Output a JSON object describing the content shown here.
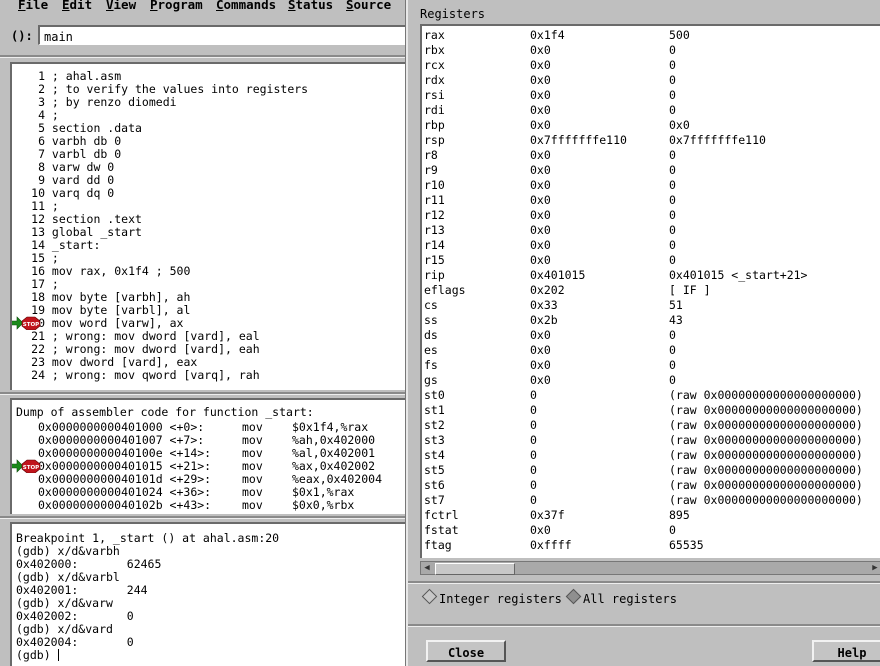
{
  "menu": [
    "File",
    "Edit",
    "View",
    "Program",
    "Commands",
    "Status",
    "Source"
  ],
  "argument": {
    "label": "():",
    "value": "main"
  },
  "source": {
    "lines": [
      {
        "n": "1",
        "text": "; ahal.asm"
      },
      {
        "n": "2",
        "text": "; to verify the values into registers"
      },
      {
        "n": "3",
        "text": "; by renzo diomedi"
      },
      {
        "n": "4",
        "text": ";"
      },
      {
        "n": "5",
        "text": "section .data"
      },
      {
        "n": "6",
        "text": "varbh db 0"
      },
      {
        "n": "7",
        "text": "varbl db 0"
      },
      {
        "n": "8",
        "text": "varw dw 0"
      },
      {
        "n": "9",
        "text": "vard dd 0"
      },
      {
        "n": "10",
        "text": "varq dq 0"
      },
      {
        "n": "11",
        "text": ";"
      },
      {
        "n": "12",
        "text": "section .text"
      },
      {
        "n": "13",
        "text": "global _start"
      },
      {
        "n": "14",
        "text": "_start:"
      },
      {
        "n": "15",
        "text": ";"
      },
      {
        "n": "16",
        "text": "mov rax, 0x1f4 ; 500"
      },
      {
        "n": "17",
        "text": ";"
      },
      {
        "n": "18",
        "text": "mov byte [varbh], ah"
      },
      {
        "n": "19",
        "text": "mov byte [varbl], al"
      },
      {
        "n": "20",
        "text": "mov word [varw], ax"
      },
      {
        "n": "21",
        "text": "; wrong: mov dword [vard], eal"
      },
      {
        "n": "22",
        "text": "; wrong: mov dword [vard], eah"
      },
      {
        "n": "23",
        "text": "mov dword [vard], eax"
      },
      {
        "n": "24",
        "text": "; wrong: mov qword [varq], rah"
      }
    ]
  },
  "assembly": {
    "header": "Dump of assembler code for function _start:",
    "lines": [
      {
        "addr": "0x0000000000401000 <+0>:",
        "op": "mov",
        "args": "$0x1f4,%rax"
      },
      {
        "addr": "0x0000000000401007 <+7>:",
        "op": "mov",
        "args": "%ah,0x402000"
      },
      {
        "addr": "0x000000000040100e <+14>:",
        "op": "mov",
        "args": "%al,0x402001"
      },
      {
        "addr": "0x0000000000401015 <+21>:",
        "op": "mov",
        "args": "%ax,0x402002"
      },
      {
        "addr": "0x000000000040101d <+29>:",
        "op": "mov",
        "args": "%eax,0x402004"
      },
      {
        "addr": "0x0000000000401024 <+36>:",
        "op": "mov",
        "args": "$0x1,%rax"
      },
      {
        "addr": "0x000000000040102b <+43>:",
        "op": "mov",
        "args": "$0x0,%rbx"
      }
    ]
  },
  "console": {
    "lines": [
      "Breakpoint 1, _start () at ahal.asm:20",
      "(gdb) x/d&varbh",
      "0x402000:       62465",
      "(gdb) x/d&varbl",
      "0x402001:       244",
      "(gdb) x/d&varw",
      "0x402002:       0",
      "(gdb) x/d&vard",
      "0x402004:       0",
      "(gdb) "
    ]
  },
  "stop_marker_text": "STOP",
  "registers_window": {
    "title": "Registers",
    "rows": [
      {
        "name": "rax",
        "hex": "0x1f4",
        "natural": "500"
      },
      {
        "name": "rbx",
        "hex": "0x0",
        "natural": "0"
      },
      {
        "name": "rcx",
        "hex": "0x0",
        "natural": "0"
      },
      {
        "name": "rdx",
        "hex": "0x0",
        "natural": "0"
      },
      {
        "name": "rsi",
        "hex": "0x0",
        "natural": "0"
      },
      {
        "name": "rdi",
        "hex": "0x0",
        "natural": "0"
      },
      {
        "name": "rbp",
        "hex": "0x0",
        "natural": "0x0"
      },
      {
        "name": "rsp",
        "hex": "0x7fffffffe110",
        "natural": "0x7fffffffe110"
      },
      {
        "name": "r8",
        "hex": "0x0",
        "natural": "0"
      },
      {
        "name": "r9",
        "hex": "0x0",
        "natural": "0"
      },
      {
        "name": "r10",
        "hex": "0x0",
        "natural": "0"
      },
      {
        "name": "r11",
        "hex": "0x0",
        "natural": "0"
      },
      {
        "name": "r12",
        "hex": "0x0",
        "natural": "0"
      },
      {
        "name": "r13",
        "hex": "0x0",
        "natural": "0"
      },
      {
        "name": "r14",
        "hex": "0x0",
        "natural": "0"
      },
      {
        "name": "r15",
        "hex": "0x0",
        "natural": "0"
      },
      {
        "name": "rip",
        "hex": "0x401015",
        "natural": "0x401015 <_start+21>"
      },
      {
        "name": "eflags",
        "hex": "0x202",
        "natural": "[ IF ]"
      },
      {
        "name": "cs",
        "hex": "0x33",
        "natural": "51"
      },
      {
        "name": "ss",
        "hex": "0x2b",
        "natural": "43"
      },
      {
        "name": "ds",
        "hex": "0x0",
        "natural": "0"
      },
      {
        "name": "es",
        "hex": "0x0",
        "natural": "0"
      },
      {
        "name": "fs",
        "hex": "0x0",
        "natural": "0"
      },
      {
        "name": "gs",
        "hex": "0x0",
        "natural": "0"
      },
      {
        "name": "st0",
        "hex": "0",
        "natural": "(raw 0x00000000000000000000)"
      },
      {
        "name": "st1",
        "hex": "0",
        "natural": "(raw 0x00000000000000000000)"
      },
      {
        "name": "st2",
        "hex": "0",
        "natural": "(raw 0x00000000000000000000)"
      },
      {
        "name": "st3",
        "hex": "0",
        "natural": "(raw 0x00000000000000000000)"
      },
      {
        "name": "st4",
        "hex": "0",
        "natural": "(raw 0x00000000000000000000)"
      },
      {
        "name": "st5",
        "hex": "0",
        "natural": "(raw 0x00000000000000000000)"
      },
      {
        "name": "st6",
        "hex": "0",
        "natural": "(raw 0x00000000000000000000)"
      },
      {
        "name": "st7",
        "hex": "0",
        "natural": "(raw 0x00000000000000000000)"
      },
      {
        "name": "fctrl",
        "hex": "0x37f",
        "natural": "895"
      },
      {
        "name": "fstat",
        "hex": "0x0",
        "natural": "0"
      },
      {
        "name": "ftag",
        "hex": "0xffff",
        "natural": "65535"
      }
    ],
    "radio_integer": "Integer registers",
    "radio_all": "All registers",
    "close_label": "Close",
    "help_label": "Help"
  }
}
